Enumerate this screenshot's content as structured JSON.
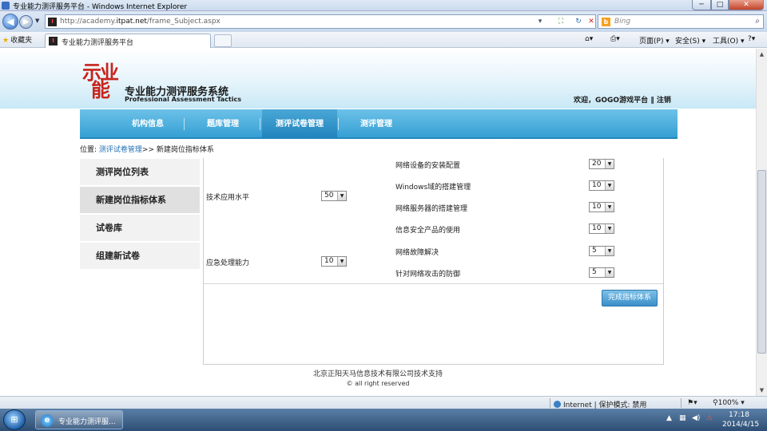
{
  "window": {
    "title": "专业能力测评服务平台 - Windows Internet Explorer",
    "min": "─",
    "max": "□",
    "close": "✕"
  },
  "browser": {
    "url_prefix": "http://academy.",
    "url_domain": "itpat.net",
    "url_suffix": "/frame_Subject.aspx",
    "search_placeholder": "Bing",
    "favorites_label": "收藏夹",
    "tab_title": "专业能力测评服务平台",
    "commands": {
      "page": "页面(P) ▾",
      "safety": "安全(S) ▾",
      "tools": "工具(O) ▾",
      "help": "?▾"
    }
  },
  "header": {
    "logo_text": "示业\n能",
    "title": "专业能力测评服务系统",
    "subtitle": "Professional Assessment Tactics",
    "welcome": "欢迎，GOGO游戏平台 ‖ 注销"
  },
  "nav": {
    "items": [
      "机构信息",
      "题库管理",
      "测评试卷管理",
      "测评管理"
    ]
  },
  "breadcrumb": {
    "prefix": "位置: ",
    "link": "测评试卷管理",
    "rest": ">> 新建岗位指标体系"
  },
  "sidebar": {
    "items": [
      "测评岗位列表",
      "新建岗位指标体系",
      "试卷库",
      "组建新试卷"
    ]
  },
  "form": {
    "groups": [
      {
        "label": "技术应用水平",
        "value": "50"
      },
      {
        "label": "应急处理能力",
        "value": "10"
      }
    ],
    "items": [
      {
        "label": "网络设备的安装配置",
        "value": "20"
      },
      {
        "label": "Windows域的搭建管理",
        "value": "10"
      },
      {
        "label": "网络服务器的搭建管理",
        "value": "10"
      },
      {
        "label": "信息安全产品的使用",
        "value": "10"
      },
      {
        "label": "网络故障解决",
        "value": "5"
      },
      {
        "label": "针对网络攻击的防御",
        "value": "5"
      }
    ],
    "finish_label": "完成指标体系"
  },
  "footer": {
    "line1": "北京正阳天马信息技术有限公司技术支持",
    "line2": "© all right reserved"
  },
  "status": {
    "zone": "Internet | 保护模式: 禁用",
    "zoom": "100%"
  },
  "taskbar": {
    "task_label": "专业能力测评服...",
    "time": "17:18",
    "date": "2014/4/15"
  }
}
